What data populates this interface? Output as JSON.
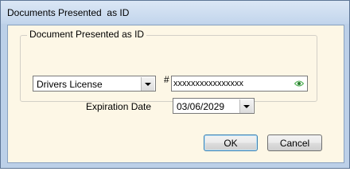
{
  "window": {
    "title": "Documents Presented  as ID"
  },
  "group": {
    "legend": "Document Presented as ID"
  },
  "document_type": {
    "selected": "Drivers License"
  },
  "id_number": {
    "hash_label": "#",
    "value": "xxxxxxxxxxxxxxxx"
  },
  "expiration": {
    "label": "Expiration Date",
    "value": "03/06/2029"
  },
  "buttons": {
    "ok": "OK",
    "cancel": "Cancel"
  },
  "icons": {
    "eye": "eye-icon",
    "dropdown": "chevron-down-icon"
  },
  "colors": {
    "title_bar": "#c2d5ec",
    "client_background": "#fdf7e6",
    "default_button_border": "#3c7fb1",
    "eye_icon": "#4caf50"
  }
}
